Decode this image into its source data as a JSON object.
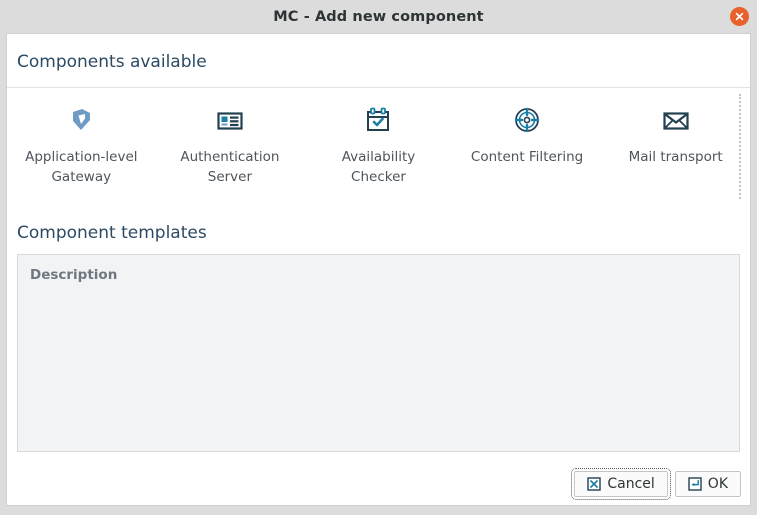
{
  "window": {
    "title": "MC - Add new component",
    "close_icon": "close-circle-icon"
  },
  "sections": {
    "components_heading": "Components available",
    "templates_heading": "Component templates"
  },
  "components": [
    {
      "label": "Application-level Gateway",
      "icon": "shield-icon"
    },
    {
      "label": "Authentication Server",
      "icon": "id-card-icon"
    },
    {
      "label": "Availability Checker",
      "icon": "calendar-check-icon"
    },
    {
      "label": "Content Filtering",
      "icon": "target-filter-icon"
    },
    {
      "label": "Mail transport",
      "icon": "envelope-icon"
    }
  ],
  "description_panel": {
    "header": "Description",
    "body": ""
  },
  "buttons": {
    "cancel": {
      "label": "Cancel",
      "icon": "x-box-icon",
      "focused": true
    },
    "ok": {
      "label": "OK",
      "icon": "enter-arrow-icon",
      "focused": false
    }
  },
  "colors": {
    "accent_close": "#e8602c",
    "heading": "#2c4a63",
    "icon_blue": "#6f9bc4",
    "icon_navy": "#23404f",
    "icon_teal": "#1b7fa8",
    "panel_bg": "#f2f3f5"
  }
}
